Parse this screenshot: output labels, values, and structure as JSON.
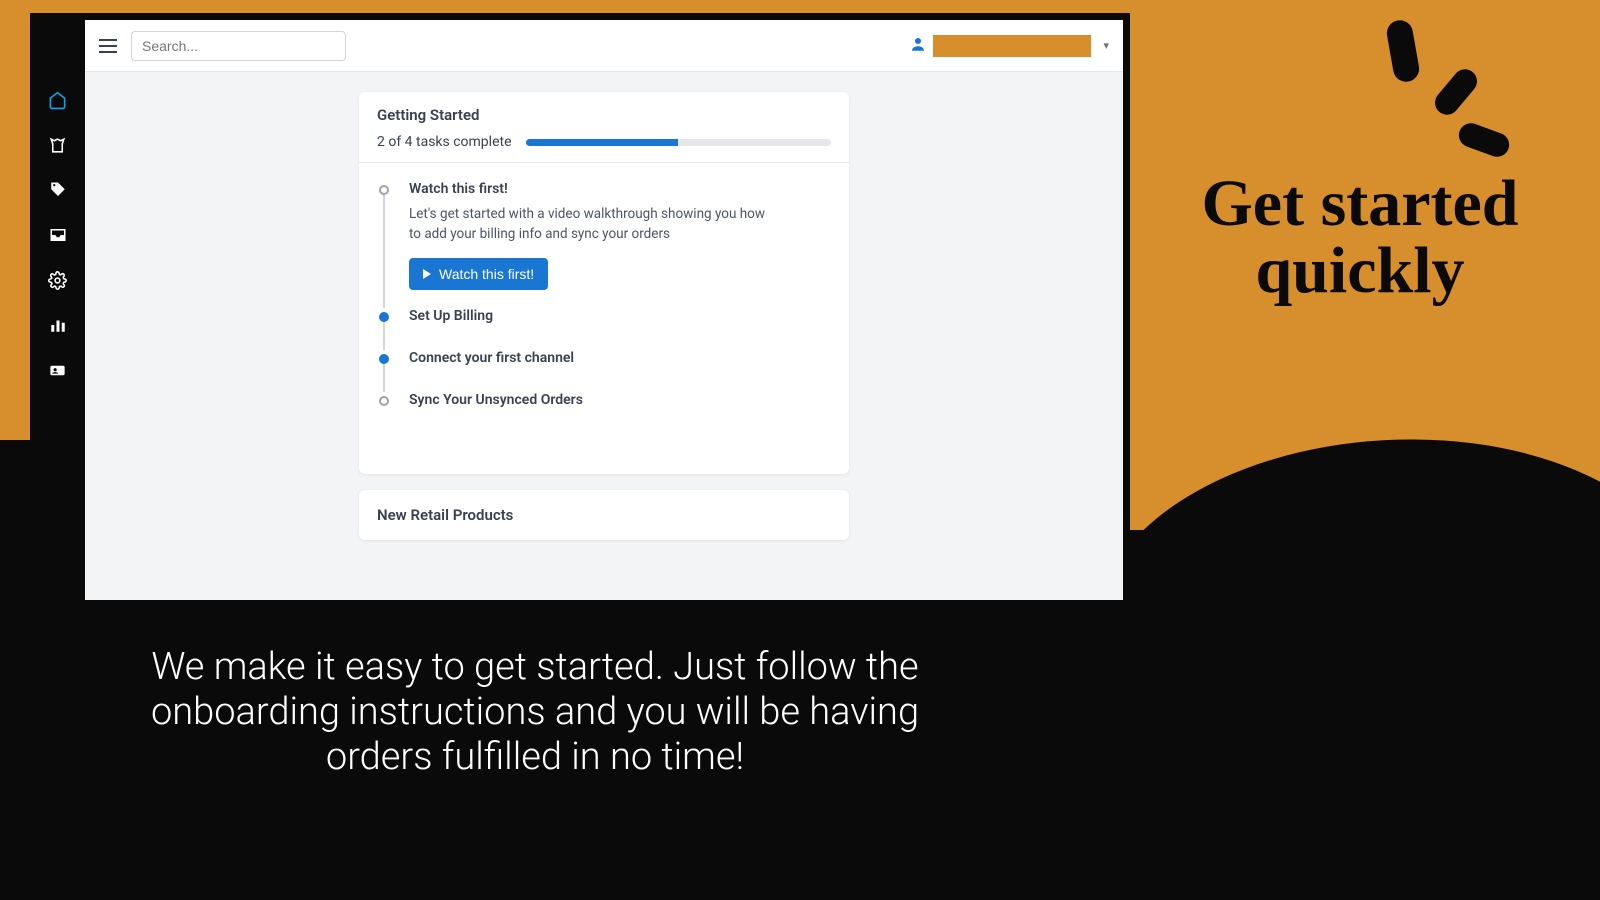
{
  "topbar": {
    "search_placeholder": "Search..."
  },
  "sidebar": {
    "icons": [
      "home",
      "shirt",
      "tag",
      "inbox",
      "gear",
      "chart",
      "id"
    ]
  },
  "card": {
    "title": "Getting Started",
    "progress_label": "2 of 4 tasks complete",
    "progress_percent": 50,
    "tasks": [
      {
        "title": "Watch this first!",
        "status": "open",
        "desc": "Let's get started with a video walkthrough showing you how to add your billing info and sync your orders",
        "button": "Watch this first!"
      },
      {
        "title": "Set Up Billing",
        "status": "done"
      },
      {
        "title": "Connect your first channel",
        "status": "done"
      },
      {
        "title": "Sync Your Unsynced Orders",
        "status": "open"
      }
    ]
  },
  "card2": {
    "title": "New Retail Products"
  },
  "hero": "Get started quickly",
  "footer": "We make it easy to get started. Just follow the onboarding instructions and you will be having orders fulfilled in no time!"
}
